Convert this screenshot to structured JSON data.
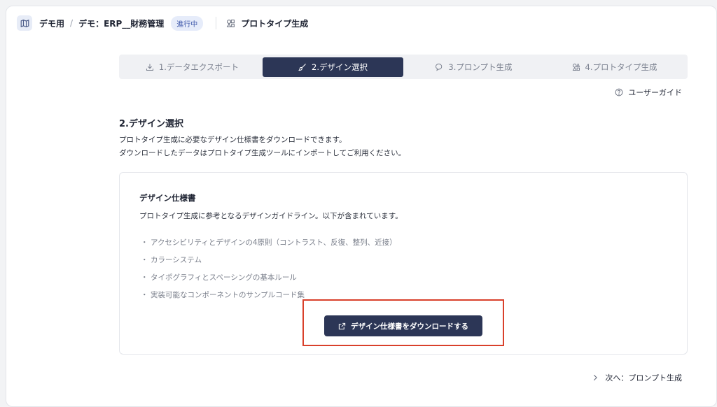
{
  "header": {
    "breadcrumb": [
      "デモ用",
      "デモ：ERP__財務管理"
    ],
    "separator": "/",
    "status_badge": "進行中",
    "right_label": "プロトタイプ生成"
  },
  "stepper": {
    "steps": [
      {
        "label": "1.データエクスポート",
        "icon": "download-icon"
      },
      {
        "label": "2.デザイン選択",
        "icon": "brush-icon",
        "active": true
      },
      {
        "label": "3.プロンプト生成",
        "icon": "chat-icon"
      },
      {
        "label": "4.プロトタイプ生成",
        "icon": "shapes-icon"
      }
    ]
  },
  "guide_link": {
    "label": "ユーザーガイド",
    "icon": "help-circle-icon"
  },
  "section": {
    "title": "2.デザイン選択",
    "desc_line1": "プロトタイプ生成に必要なデザイン仕様書をダウンロードできます。",
    "desc_line2": "ダウンロードしたデータはプロトタイプ生成ツールにインポートしてご利用ください。"
  },
  "panel": {
    "title": "デザイン仕様書",
    "desc": "プロトタイプ生成に参考となるデザインガイドライン。以下が含まれています。",
    "bullet": "・",
    "items": [
      "アクセシビリティとデザインの4原則（コントラスト、反復、整列、近接）",
      "カラーシステム",
      "タイポグラフィとスペーシングの基本ルール",
      "実装可能なコンポーネントのサンプルコード集"
    ],
    "download_button": "デザイン仕様書をダウンロードする"
  },
  "next_link": {
    "label": "次へ：プロンプト生成",
    "icon": "chevron-right-icon"
  },
  "colors": {
    "primary": "#2c3656",
    "badge_text": "#3b55a8",
    "badge_bg": "#e6ecfa",
    "highlight": "#d9402b"
  }
}
